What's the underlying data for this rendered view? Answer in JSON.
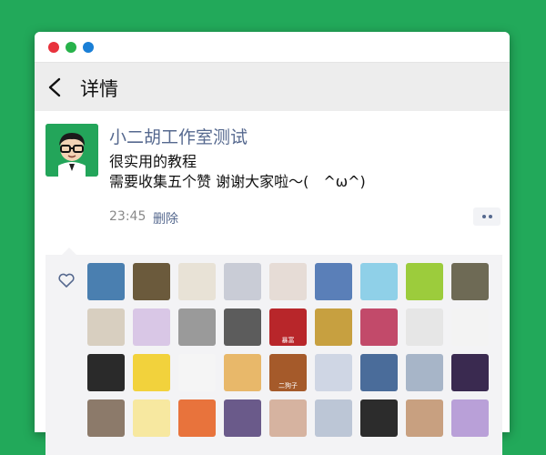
{
  "nav": {
    "title": "详情"
  },
  "post": {
    "author": "小二胡工作室测试",
    "line1": "很实用的教程",
    "line2": "需要收集五个赞 谢谢大家啦～(　^ω^)",
    "time": "23:45",
    "delete_label": "删除"
  },
  "likes": {
    "avatars": [
      {
        "name": "avatar-1",
        "bg": "#4a7fb0"
      },
      {
        "name": "avatar-2",
        "bg": "#6b5a3c"
      },
      {
        "name": "avatar-3",
        "bg": "#e8e2d6"
      },
      {
        "name": "avatar-4",
        "bg": "#c9ccd6"
      },
      {
        "name": "avatar-5",
        "bg": "#e6dcd6"
      },
      {
        "name": "avatar-6",
        "bg": "#5a7fb8"
      },
      {
        "name": "avatar-7",
        "bg": "#8fd0e8"
      },
      {
        "name": "avatar-8",
        "bg": "#9ccc3c"
      },
      {
        "name": "avatar-9",
        "bg": "#6e6a55"
      },
      {
        "name": "avatar-10",
        "bg": "#d8cfc0"
      },
      {
        "name": "avatar-11",
        "bg": "#d9c7e6"
      },
      {
        "name": "avatar-12",
        "bg": "#9a9a9a"
      },
      {
        "name": "avatar-13",
        "bg": "#5c5c5c"
      },
      {
        "name": "avatar-14",
        "bg": "#b8262a",
        "text": "暴富"
      },
      {
        "name": "avatar-15",
        "bg": "#c7a040"
      },
      {
        "name": "avatar-16",
        "bg": "#c24a6a"
      },
      {
        "name": "avatar-17",
        "bg": "#e6e6e6"
      },
      {
        "name": "avatar-18",
        "bg": "#f3f3f3"
      },
      {
        "name": "avatar-19",
        "bg": "#2a2a2a"
      },
      {
        "name": "avatar-20",
        "bg": "#f2d23c"
      },
      {
        "name": "avatar-21",
        "bg": "#f5f5f5"
      },
      {
        "name": "avatar-22",
        "bg": "#e8b86a"
      },
      {
        "name": "avatar-23",
        "bg": "#a55a2a",
        "text": "二狗子"
      },
      {
        "name": "avatar-24",
        "bg": "#cfd6e4"
      },
      {
        "name": "avatar-25",
        "bg": "#4a6c9a"
      },
      {
        "name": "avatar-26",
        "bg": "#a7b5c8"
      },
      {
        "name": "avatar-27",
        "bg": "#3a2a50"
      },
      {
        "name": "avatar-28",
        "bg": "#8c7a6a"
      },
      {
        "name": "avatar-29",
        "bg": "#f7e8a0"
      },
      {
        "name": "avatar-30",
        "bg": "#e8733c"
      },
      {
        "name": "avatar-31",
        "bg": "#6a5a8a"
      },
      {
        "name": "avatar-32",
        "bg": "#d6b3a0"
      },
      {
        "name": "avatar-33",
        "bg": "#bcc6d6"
      },
      {
        "name": "avatar-34",
        "bg": "#2c2c2c"
      },
      {
        "name": "avatar-35",
        "bg": "#c8a080"
      },
      {
        "name": "avatar-36",
        "bg": "#b9a0d8"
      }
    ]
  }
}
